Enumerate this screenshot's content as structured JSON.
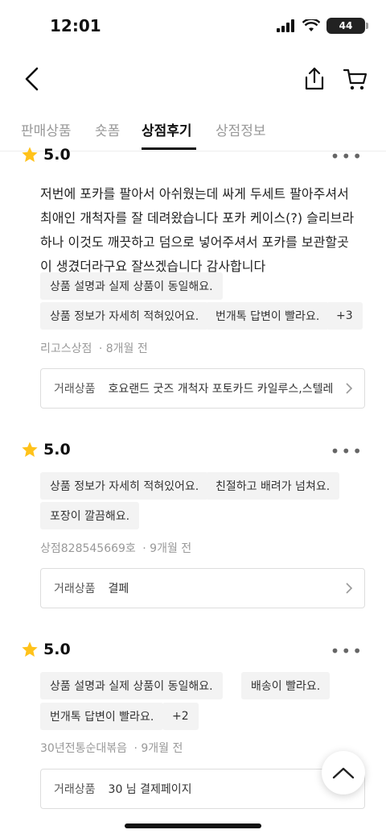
{
  "status_bar": {
    "time": "12:01",
    "battery": "44"
  },
  "nav": {
    "back_icon": "chevron-left-icon",
    "share_icon": "share-icon",
    "cart_icon": "cart-icon"
  },
  "tabs": [
    {
      "label": "판매상품",
      "active": false
    },
    {
      "label": "숏폼",
      "active": false
    },
    {
      "label": "상점후기",
      "active": true
    },
    {
      "label": "상점정보",
      "active": false
    }
  ],
  "reviews": [
    {
      "rating": "5.0",
      "text": [
        "저번에 포카를 팔아서 아쉬웠는데 싸게 두세트 팔아주셔서",
        "최애인 개척자를 잘 데려왔습니다 포카 케이스(?) 슬리브라",
        "하나 이것도 깨끗하고 덤으로 넣어주셔서 포카를 보관할곳",
        "이 생겼더라구요 잘쓰겠습니다 감사합니다"
      ],
      "tags": [
        "상품 설명과 실제 상품이 동일해요.",
        "상품 정보가 자세히 적혀있어요.",
        "번개톡 답변이 빨라요.",
        "+3"
      ],
      "author": "리고스상점",
      "time": "· 8개월 전",
      "product_label": "거래상품",
      "product_name": "호요랜드 굿즈 개척자 포토카드 카일루스,스텔레"
    },
    {
      "rating": "5.0",
      "tags": [
        "상품 정보가 자세히 적혀있어요.",
        "친절하고 배려가 넘쳐요.",
        "포장이 깔끔해요."
      ],
      "author": "상점828545669호",
      "time": "· 9개월 전",
      "product_label": "거래상품",
      "product_name": "결페"
    },
    {
      "rating": "5.0",
      "tags": [
        "상품 설명과 실제 상품이 동일해요.",
        "배송이 빨라요.",
        "번개톡 답변이 빨라요.",
        "+2"
      ],
      "author": "30년전통순대볶음",
      "time": "· 9개월 전",
      "product_label": "거래상품",
      "product_name": "30 님 결제페이지"
    }
  ],
  "more_symbol": "•••",
  "colors": {
    "star": "#FFC21A",
    "tag_bg": "#F3F3F3",
    "active_tab": "#111111",
    "inactive_tab": "#999999"
  }
}
